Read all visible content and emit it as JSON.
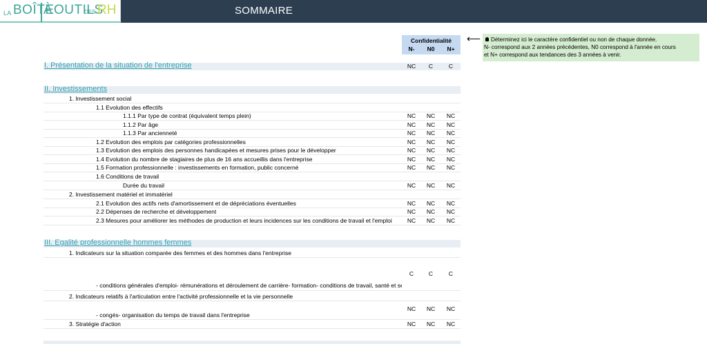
{
  "header": {
    "logo": {
      "la": "LA",
      "boite": "BOÎTE",
      "a": "À",
      "outils": "OUTILS",
      "des": "DES",
      "rh": "RH"
    },
    "title": "SOMMAIRE"
  },
  "confidentiality": {
    "title": "Confidentialité",
    "columns": [
      "N-",
      "N0",
      "N+"
    ]
  },
  "note": {
    "lines": [
      "Déterminez ici le caractère confidentiel ou non de chaque donnée.",
      "N- correspond aux 2 années précédentes, N0 correspond à l'année en cours",
      "et N+ correspond aux tendances des 3 années à venir."
    ]
  },
  "sections": [
    {
      "label": "I. Présentation de la situation de l'entreprise",
      "values": [
        "NC",
        "C",
        "C"
      ]
    },
    {
      "label": "II. Investissements",
      "values": []
    },
    {
      "label": "III. Egalité professionnelle hommes femmes",
      "values": []
    }
  ],
  "rows": [
    {
      "text": "1. Investissement social",
      "values": []
    },
    {
      "text": "1.1 Evolution des effectifs",
      "values": []
    },
    {
      "text": "1.1.1  Par type de contrat (équivalent temps plein)",
      "values": [
        "NC",
        "NC",
        "NC"
      ]
    },
    {
      "text": "1.1.2  Par âge",
      "values": [
        "NC",
        "NC",
        "NC"
      ]
    },
    {
      "text": "1.1.3  Par ancienneté",
      "values": [
        "NC",
        "NC",
        "NC"
      ]
    },
    {
      "text": "1.2 Evolution des emplois par catégories professionnelles",
      "values": [
        "NC",
        "NC",
        "NC"
      ]
    },
    {
      "text": "1.3 Evolution des emplois des personnes handicapées et mesures prises pour le développer",
      "values": [
        "NC",
        "NC",
        "NC"
      ]
    },
    {
      "text": "1.4 Evolution du nombre de stagiaires de plus de 16 ans accueillis dans l'entreprise",
      "values": [
        "NC",
        "NC",
        "NC"
      ]
    },
    {
      "text": "1.5 Formation professionnelle : investissements en formation, public concerné",
      "values": [
        "NC",
        "NC",
        "NC"
      ]
    },
    {
      "text": "1.6 Conditions de travail",
      "values": []
    },
    {
      "text": "Durée du travail",
      "values": [
        "NC",
        "NC",
        "NC"
      ]
    },
    {
      "text": "2. Investissement matériel et immatériel",
      "values": []
    },
    {
      "text": "2.1 Evolution des actifs nets d'amortissement et de dépréciations éventuelles",
      "values": [
        "NC",
        "NC",
        "NC"
      ]
    },
    {
      "text": "2.2 Dépenses de recherche et développement",
      "values": [
        "NC",
        "NC",
        "NC"
      ]
    },
    {
      "text": "2.3 Mesures pour améliorer les méthodes de production et leurs incidences sur les conditions de travail et l'emploi",
      "values": [
        "NC",
        "NC",
        "NC"
      ]
    },
    {
      "text": "1. Indicateurs sur la situation comparée des femmes et des hommes dans l'entreprise",
      "values": []
    },
    {
      "text": "",
      "values": [
        "C",
        "C",
        "C"
      ]
    },
    {
      "text": "- conditions générales d'emploi- rémunérations et déroulement de carrière- formation- conditions de travail, santé et sécurité",
      "values": []
    },
    {
      "text": "2. Indicateurs relatifs à l'articulation entre l'activité professionnelle et la vie personnelle",
      "values": []
    },
    {
      "text": "",
      "values": [
        "NC",
        "NC",
        "NC"
      ]
    },
    {
      "text": "- congés- organisation du temps de travail dans l'entreprise",
      "values": []
    },
    {
      "text": "3. Stratégie d'action",
      "values": [
        "NC",
        "NC",
        "NC"
      ]
    }
  ]
}
